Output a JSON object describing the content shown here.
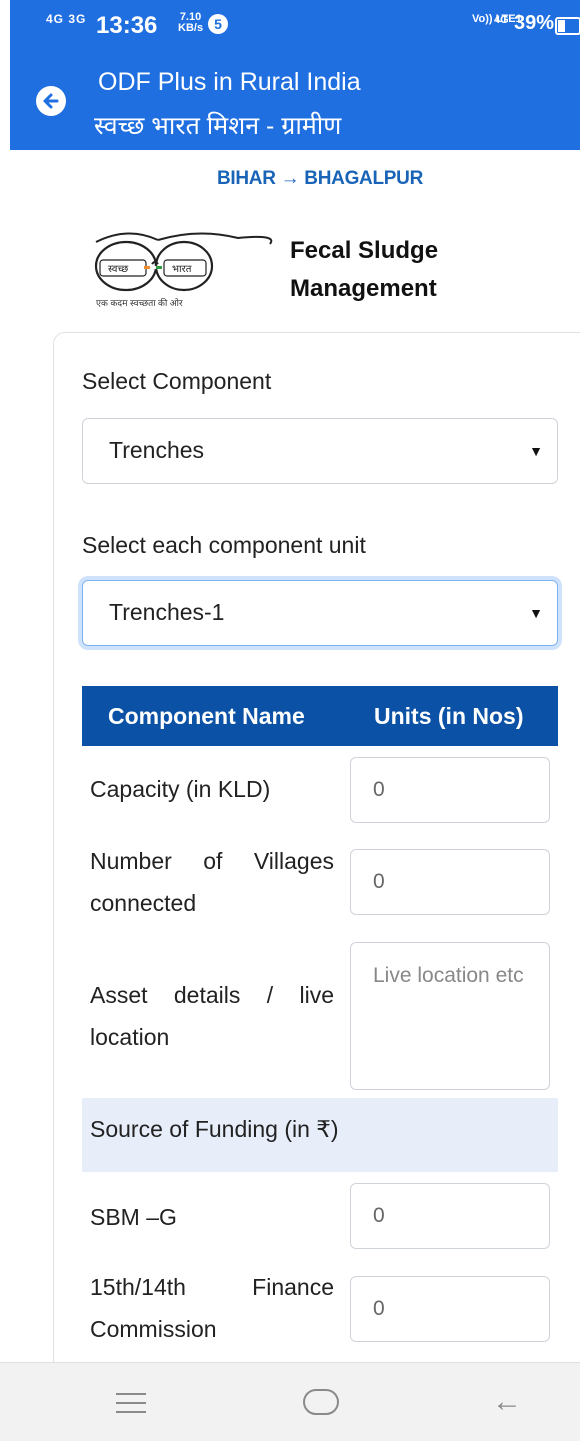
{
  "status_bar": {
    "network": "4G 3G",
    "time": "13:36",
    "speed": "7.10",
    "speed_unit": "KB/s",
    "badge": "5",
    "volte": "Vo)) LTE1",
    "signal": "4G",
    "battery": "39%"
  },
  "app_bar": {
    "title": "ODF Plus in Rural India",
    "subtitle": "स्वच्छ भारत मिशन - ग्रामीण"
  },
  "breadcrumb": "BIHAR → BHAGALPUR",
  "logo": {
    "left_word": "स्वच्छ",
    "right_word": "भारत",
    "tagline": "एक कदम स्वच्छता की ओर"
  },
  "section_title_line1": "Fecal Sludge",
  "section_title_line2": "Management",
  "form": {
    "component_label": "Select Component",
    "component_value": "Trenches",
    "unit_label": "Select each component unit",
    "unit_value": "Trenches-1",
    "table_header": {
      "col1": "Component Name",
      "col2": "Units (in Nos)"
    },
    "rows": [
      {
        "label": "Capacity (in KLD)",
        "value": "0"
      },
      {
        "label": "Number of Villages connected",
        "value": "0"
      },
      {
        "label": "Asset details / live location",
        "placeholder": "Live location etc"
      }
    ],
    "funding_header": "Source of Funding (in ₹)",
    "funding_rows": [
      {
        "label": "SBM –G",
        "value": "0"
      },
      {
        "label": "15th/14th Finance Commission",
        "value": "0"
      }
    ]
  }
}
